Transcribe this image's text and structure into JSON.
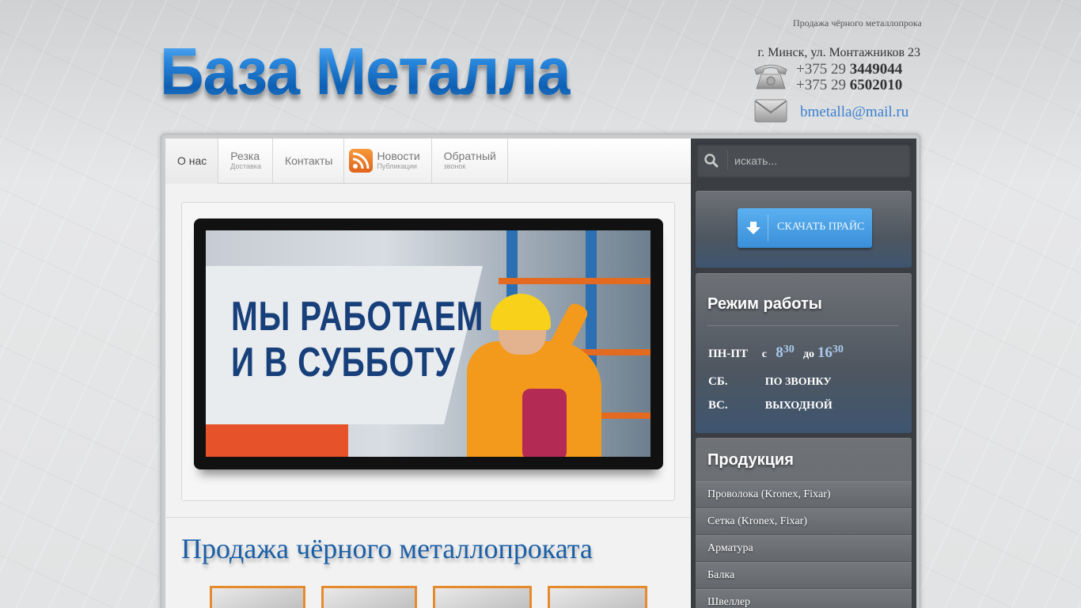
{
  "header": {
    "tagline": "Продажа чёрного металлопроката",
    "logo": "База Металла",
    "address": "г. Минск, ул. Монтажников 23",
    "phones": [
      {
        "prefix": "+375 29 ",
        "number": "3449044"
      },
      {
        "prefix": "+375 29 ",
        "number": "6502010"
      }
    ],
    "email": "bmetalla@mail.ru"
  },
  "nav": {
    "items": [
      {
        "label": "О нас",
        "sub": ""
      },
      {
        "label": "Резка",
        "sub": "Доставка"
      },
      {
        "label": "Контакты",
        "sub": ""
      },
      {
        "label": "Новости",
        "sub": "Публикации"
      },
      {
        "label": "Обратный",
        "sub": "звонок"
      }
    ]
  },
  "slider": {
    "text_line1": "МЫ РАБОТАЕМ",
    "text_line2": "И В СУББОТУ"
  },
  "main": {
    "heading": "Продажа чёрного металлопроката"
  },
  "search": {
    "placeholder": "искать..."
  },
  "download": {
    "label": "СКАЧАТЬ ПРАЙС"
  },
  "hours": {
    "title": "Режим работы",
    "weekday": {
      "day": "ПН-ПТ",
      "from_word": "с",
      "from_h": "8",
      "from_m": "30",
      "to_word": "до",
      "to_h": "16",
      "to_m": "30"
    },
    "saturday": {
      "day": "СБ.",
      "text": "ПО ЗВОНКУ"
    },
    "sunday": {
      "day": "ВС.",
      "text": "ВЫХОДНОЙ"
    }
  },
  "products": {
    "title": "Продукция",
    "items": [
      "Проволока (Kronex, Fixar)",
      "Сетка (Kronex, Fixar)",
      "Арматура",
      "Балка",
      "Швеллер"
    ]
  },
  "colors": {
    "accent": "#1b5fa6",
    "email": "#3b7fd0",
    "button": "#4aa0e6",
    "thumb_border": "#e68a2e"
  }
}
